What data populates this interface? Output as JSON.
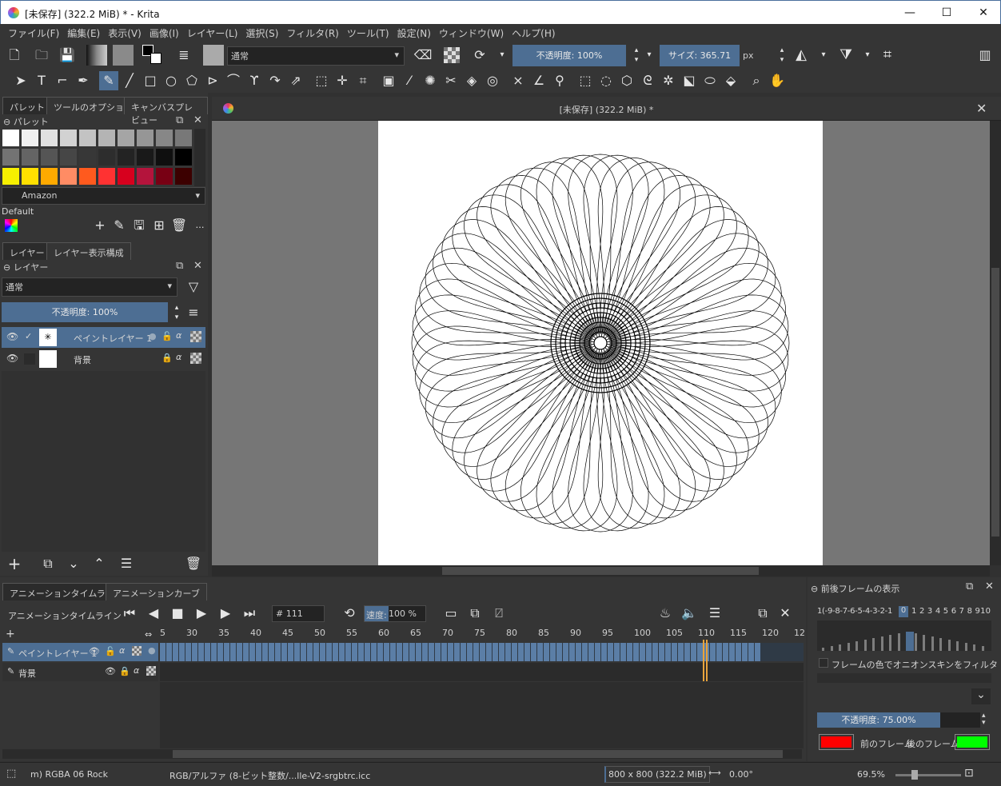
{
  "window": {
    "title": "[未保存]  (322.2 MiB) * - Krita",
    "minimize": "—",
    "maximize": "☐",
    "close": "✕"
  },
  "menu": [
    "ファイル(F)",
    "編集(E)",
    "表示(V)",
    "画像(I)",
    "レイヤー(L)",
    "選択(S)",
    "フィルタ(R)",
    "ツール(T)",
    "設定(N)",
    "ウィンドウ(W)",
    "ヘルプ(H)"
  ],
  "toolbar": {
    "blend_mode": "通常",
    "opacity": "不透明度: 100%",
    "size_label": "サイズ: 365.71",
    "size_unit": "px"
  },
  "left_top_tabs": [
    "パレット",
    "ツールのオプション",
    "キャンバスプレビュー"
  ],
  "palette": {
    "title": "パレット",
    "colors": [
      [
        "#ffffff",
        "#f0f0f0",
        "#e1e1e1",
        "#d2d2d2",
        "#c3c3c3",
        "#b4b4b4",
        "#a5a5a5",
        "#969696",
        "#878787",
        "#787878"
      ],
      [
        "#737373",
        "#646464",
        "#555555",
        "#464646",
        "#373737",
        "#2d2d2d",
        "#232323",
        "#191919",
        "#0f0f0f",
        "#000000"
      ],
      [
        "#f7f000",
        "#ffe000",
        "#ffaa00",
        "#ff8c64",
        "#ff5a1e",
        "#ff3232",
        "#d7001e",
        "#b4143c",
        "#780014",
        "#3c0000"
      ]
    ],
    "palette_name": "Amazon",
    "default_label": "Default"
  },
  "layers_tabs": [
    "レイヤー",
    "レイヤー表示構成"
  ],
  "layers": {
    "title": "レイヤー",
    "blend": "通常",
    "opacity": "不透明度:  100%",
    "items": [
      {
        "name": "ペイントレイヤー 1"
      },
      {
        "name": "背景"
      }
    ]
  },
  "document": {
    "tab_title": "[未保存]  (322.2 MiB) *"
  },
  "timeline": {
    "tabs": [
      "アニメーションタイムライン",
      "アニメーションカーブ"
    ],
    "title": "アニメーションタイムライン",
    "frame": "# 111",
    "speed_label": "速度:",
    "speed_value": "100 %",
    "ruler": [
      "5",
      "30",
      "35",
      "40",
      "45",
      "50",
      "55",
      "60",
      "65",
      "70",
      "75",
      "80",
      "85",
      "90",
      "95",
      "100",
      "105",
      "110",
      "115",
      "120",
      "12"
    ],
    "layers": [
      "ペイントレイヤー 1",
      "背景"
    ]
  },
  "onion": {
    "title": "前後フレームの表示",
    "numbers": "1(-9-8-7-6-5-4-3-2-1",
    "zero": "0",
    "pos_numbers": "1 2 3 4 5 6 7 8 910",
    "filter_label": "フレームの色でオニオンスキンをフィルタ",
    "opacity": "不透明度: 75.00%",
    "prev_label": "前のフレーム",
    "next_label": "後のフレーム",
    "prev_color": "#ff0000",
    "next_color": "#00ff00"
  },
  "status": {
    "brush": "m) RGBA 06 Rock",
    "colorspace": "RGB/アルファ (8-ビット整数/...lle-V2-srgbtrc.icc",
    "dimensions": "800 x 800 (322.2 MiB)",
    "rotation": "0.00°",
    "zoom": "69.5%"
  }
}
